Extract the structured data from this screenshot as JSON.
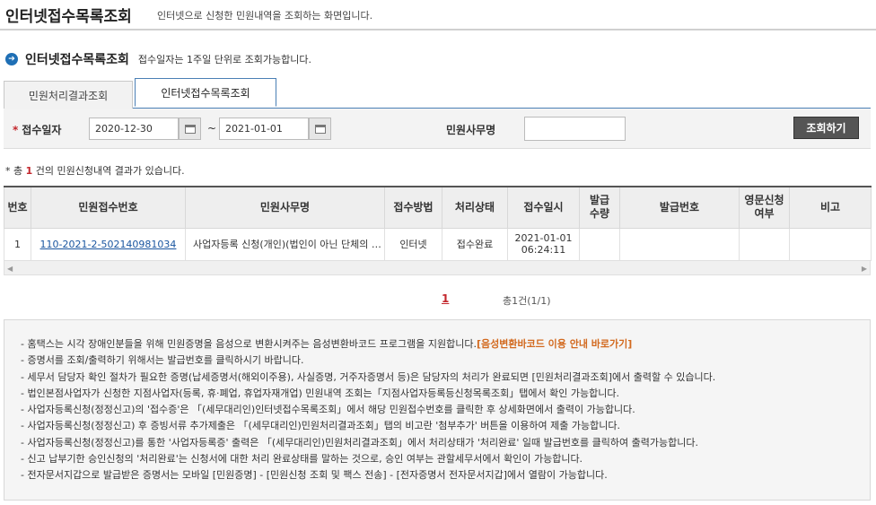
{
  "header": {
    "title": "인터넷접수목록조회",
    "description": "인터넷으로 신청한 민원내역을 조회하는 화면입니다."
  },
  "section": {
    "title": "인터넷접수목록조회",
    "note": "접수일자는 1주일 단위로 조회가능합니다."
  },
  "tabs": [
    {
      "label": "민원처리결과조회",
      "active": false
    },
    {
      "label": "인터넷접수목록조회",
      "active": true
    }
  ],
  "search": {
    "required_mark": "*",
    "date_label": "접수일자",
    "date_from": "2020-12-30",
    "date_sep": "~",
    "date_to": "2021-01-01",
    "office_label": "민원사무명",
    "office_value": "",
    "button": "조회하기"
  },
  "result": {
    "prefix": "* 총",
    "count": "1",
    "suffix": "건의 민원신청내역 결과가 있습니다."
  },
  "table": {
    "headers": [
      "번호",
      "민원접수번호",
      "민원사무명",
      "접수방법",
      "처리상태",
      "접수일시",
      "발급\n수량",
      "발급번호",
      "영문신청\n여부",
      "비고"
    ],
    "rows": [
      {
        "no": "1",
        "receipt_no": "110-2021-2-502140981034",
        "office": "사업자등록 신청(개인)(법인이 아닌 단체의 고유번호 신청)",
        "method": "인터넷",
        "status": "접수완료",
        "datetime": "2021-01-01\n06:24:11",
        "issue_qty": "",
        "issue_no": "",
        "english": "",
        "remark": ""
      }
    ]
  },
  "paging": {
    "current": "1",
    "total": "총1건(1/1)"
  },
  "notices": [
    {
      "text": "- 홈택스는 시각 장애인분들을 위해 민원증명을 음성으로 변환시켜주는 음성변환바코드 프로그램을 지원합니다.",
      "link": "[음성변환바코드 이용 안내 바로가기]"
    },
    {
      "text": "- 증명서를 조회/출력하기 위해서는 발급번호를 클릭하시기 바랍니다."
    },
    {
      "text": "- 세무서 담당자 확인 절차가 필요한 증명(납세증명서(해외이주용), 사실증명, 거주자증명서 등)은 담당자의 처리가 완료되면 [민원처리결과조회]에서 출력할 수 있습니다."
    },
    {
      "text": "- 법인본점사업자가 신청한 지점사업자(등록, 휴·폐업, 휴업자재개업) 민원내역 조회는「지점사업자등록등신청목록조회」탭에서 확인 가능합니다."
    },
    {
      "text": "- 사업자등록신청(정정신고)의 '접수증'은 「(세무대리인)인터넷접수목록조회」에서 해당 민원접수번호를 클릭한 후 상세화면에서 출력이 가능합니다."
    },
    {
      "text": "- 사업자등록신청(정정신고) 후 증빙서류 추가제출은 「(세무대리인)민원처리결과조회」탭의 비고란 '첨부추가' 버튼을 이용하여 제출 가능합니다."
    },
    {
      "text": "- 사업자등록신청(정정신고)를 통한 '사업자등록증' 출력은 「(세무대리인)민원처리결과조회」에서 처리상태가 '처리완료' 일때 발급번호를 클릭하여 출력가능합니다."
    },
    {
      "text": "- 신고 납부기한 승인신청의 '처리완료'는 신청서에 대한 처리 완료상태를 말하는 것으로, 승인 여부는 관할세무서에서 확인이 가능합니다."
    },
    {
      "text": "- 전자문서지갑으로 발급받은 증명서는 모바일 [민원증명] - [민원신청 조회 및 팩스 전송] - [전자증명서 전자문서지갑]에서 열람이 가능합니다."
    }
  ],
  "colors": {
    "required": "#c3262c",
    "link": "#1a56a0",
    "accent_link": "#d2691e",
    "button_bg": "#555555"
  },
  "icons": [
    "info-bullet-icon",
    "calendar-icon",
    "scroll-left-icon",
    "scroll-right-icon"
  ]
}
